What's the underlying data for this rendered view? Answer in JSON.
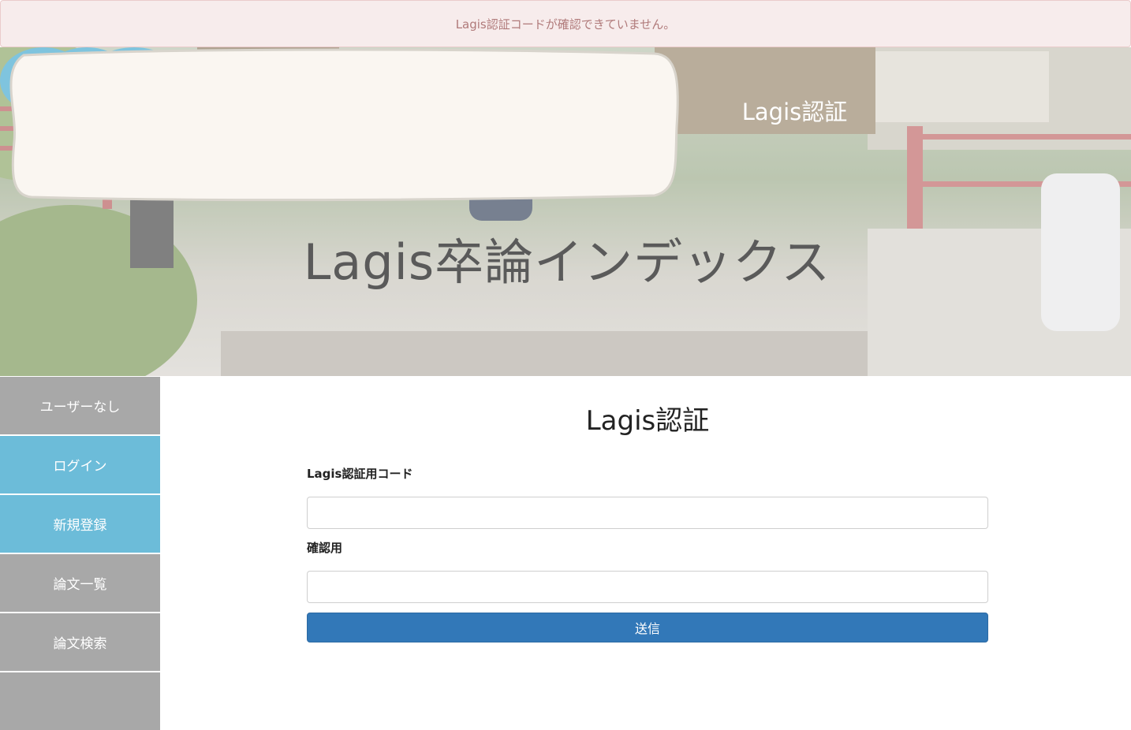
{
  "alert": {
    "message": "Lagis認証コードが確認できていません。"
  },
  "header": {
    "bubble_label": "Lagis認証",
    "site_title": "Lagis卒論インデックス"
  },
  "sidebar": {
    "items": [
      {
        "label": "ユーザーなし",
        "color": "#a8a8a8"
      },
      {
        "label": "ログイン",
        "color": "#6cbcd9"
      },
      {
        "label": "新規登録",
        "color": "#6cbcd9"
      },
      {
        "label": "論文一覧",
        "color": "#a8a8a8"
      },
      {
        "label": "論文検索",
        "color": "#a8a8a8"
      },
      {
        "label": "",
        "color": "#a8a8a8"
      }
    ]
  },
  "form": {
    "title": "Lagis認証",
    "code_label": "Lagis認証用コード",
    "code_value": "",
    "confirm_label": "確認用",
    "confirm_value": "",
    "submit_label": "送信"
  },
  "colors": {
    "accent_blue": "#6cbcd9",
    "button_blue": "#3278b8",
    "alert_bg": "#f7ecec",
    "alert_text": "#b07a7a"
  }
}
